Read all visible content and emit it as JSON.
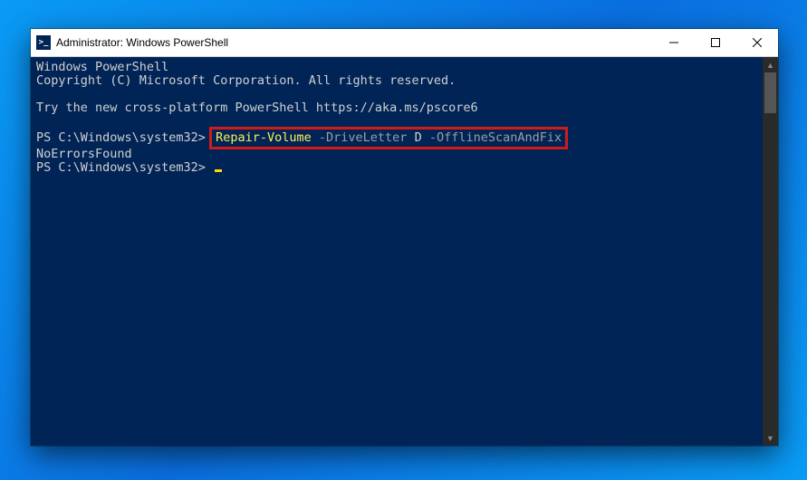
{
  "window": {
    "title": "Administrator: Windows PowerShell"
  },
  "terminal": {
    "banner_line1": "Windows PowerShell",
    "banner_line2": "Copyright (C) Microsoft Corporation. All rights reserved.",
    "try_line_prefix": "Try the new cross-platform PowerShell ",
    "try_link": "https://aka.ms/pscore6",
    "prompt_path": "PS C:\\Windows\\system32>",
    "command": {
      "cmdlet": "Repair-Volume",
      "param1": "-DriveLetter",
      "arg1": "D",
      "param2": "-OfflineScanAndFix"
    },
    "output_line": "NoErrorsFound"
  },
  "colors": {
    "terminal_bg": "#012456",
    "highlight_border": "#d11b1b",
    "cmdlet": "#ffee58",
    "param": "#9e9e9e",
    "text": "#d0d0d0"
  }
}
